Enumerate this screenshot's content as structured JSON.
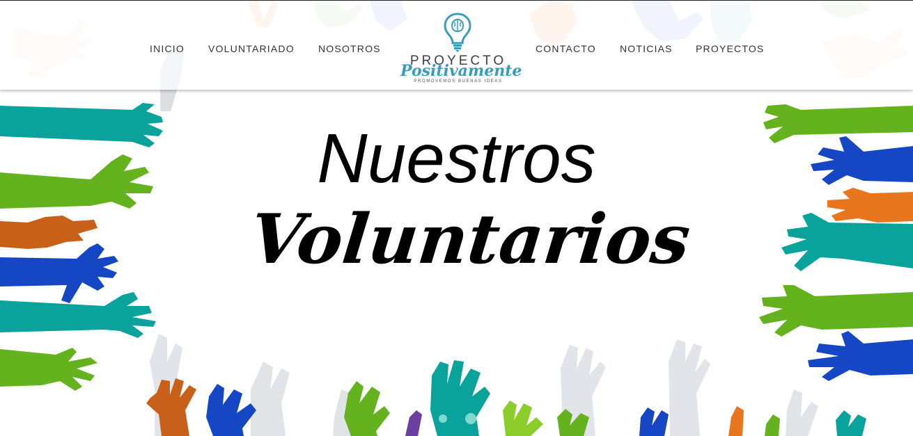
{
  "nav": {
    "left": [
      "INICIO",
      "VOLUNTARIADO",
      "NOSOTROS"
    ],
    "right": [
      "CONTACTO",
      "NOTICIAS",
      "PROYECTOS"
    ]
  },
  "logo": {
    "line1": "PROYECTO",
    "line2": "Positivamente",
    "tagline": "PROMOVEMOS BUENAS IDEAS",
    "icon": "lightbulb-brain-icon",
    "color": "#3b9bb8"
  },
  "hero": {
    "title": "Nuestros",
    "subtitle": "Voluntarios"
  },
  "colors": {
    "teal": "#0aa39b",
    "green": "#64b31e",
    "blue": "#1546c4",
    "orange": "#e8761c",
    "rust": "#c9601a",
    "light_gray": "#dfe3e8"
  }
}
